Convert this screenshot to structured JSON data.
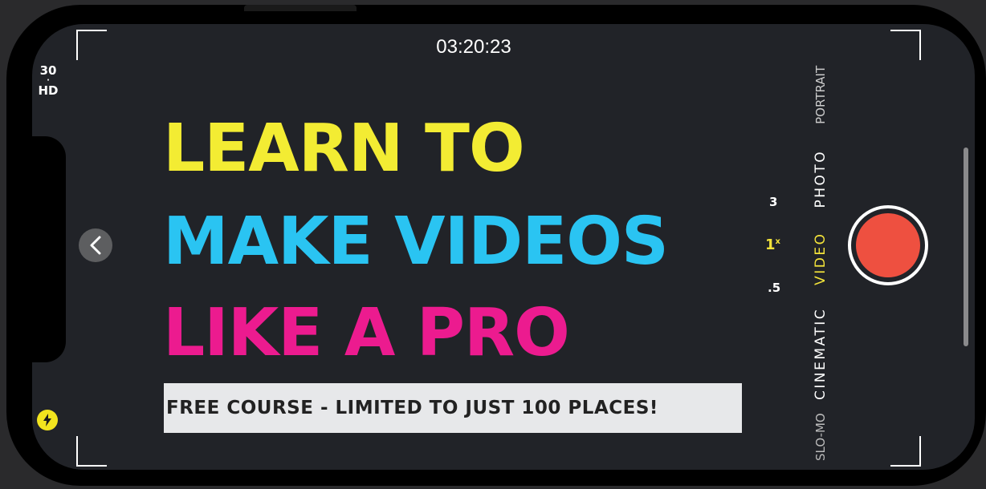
{
  "camera": {
    "timer": "03:20:23",
    "fps": "30",
    "fps_separator": "·",
    "resolution": "HD",
    "zoom_levels": [
      "3",
      "1",
      ".5"
    ],
    "zoom_selected_suffix": "x",
    "modes": [
      "SLO-MO",
      "CINEMATIC",
      "VIDEO",
      "PHOTO",
      "PORTRAIT"
    ],
    "selected_mode": "VIDEO",
    "icons": {
      "back": "chevron-left-icon",
      "flash": "lightning-bolt-icon",
      "record": "record-icon"
    },
    "colors": {
      "record": "#ee5040",
      "selected": "#f3e33a"
    }
  },
  "headline": {
    "line1": "LEARN TO",
    "line2": "MAKE VIDEOS",
    "line3": "LIKE A PRO",
    "colors": [
      "#f3ec33",
      "#2ac4f2",
      "#ec1b8f"
    ]
  },
  "banner": {
    "text": "FREE COURSE - LIMITED TO JUST 100 PLACES!"
  }
}
